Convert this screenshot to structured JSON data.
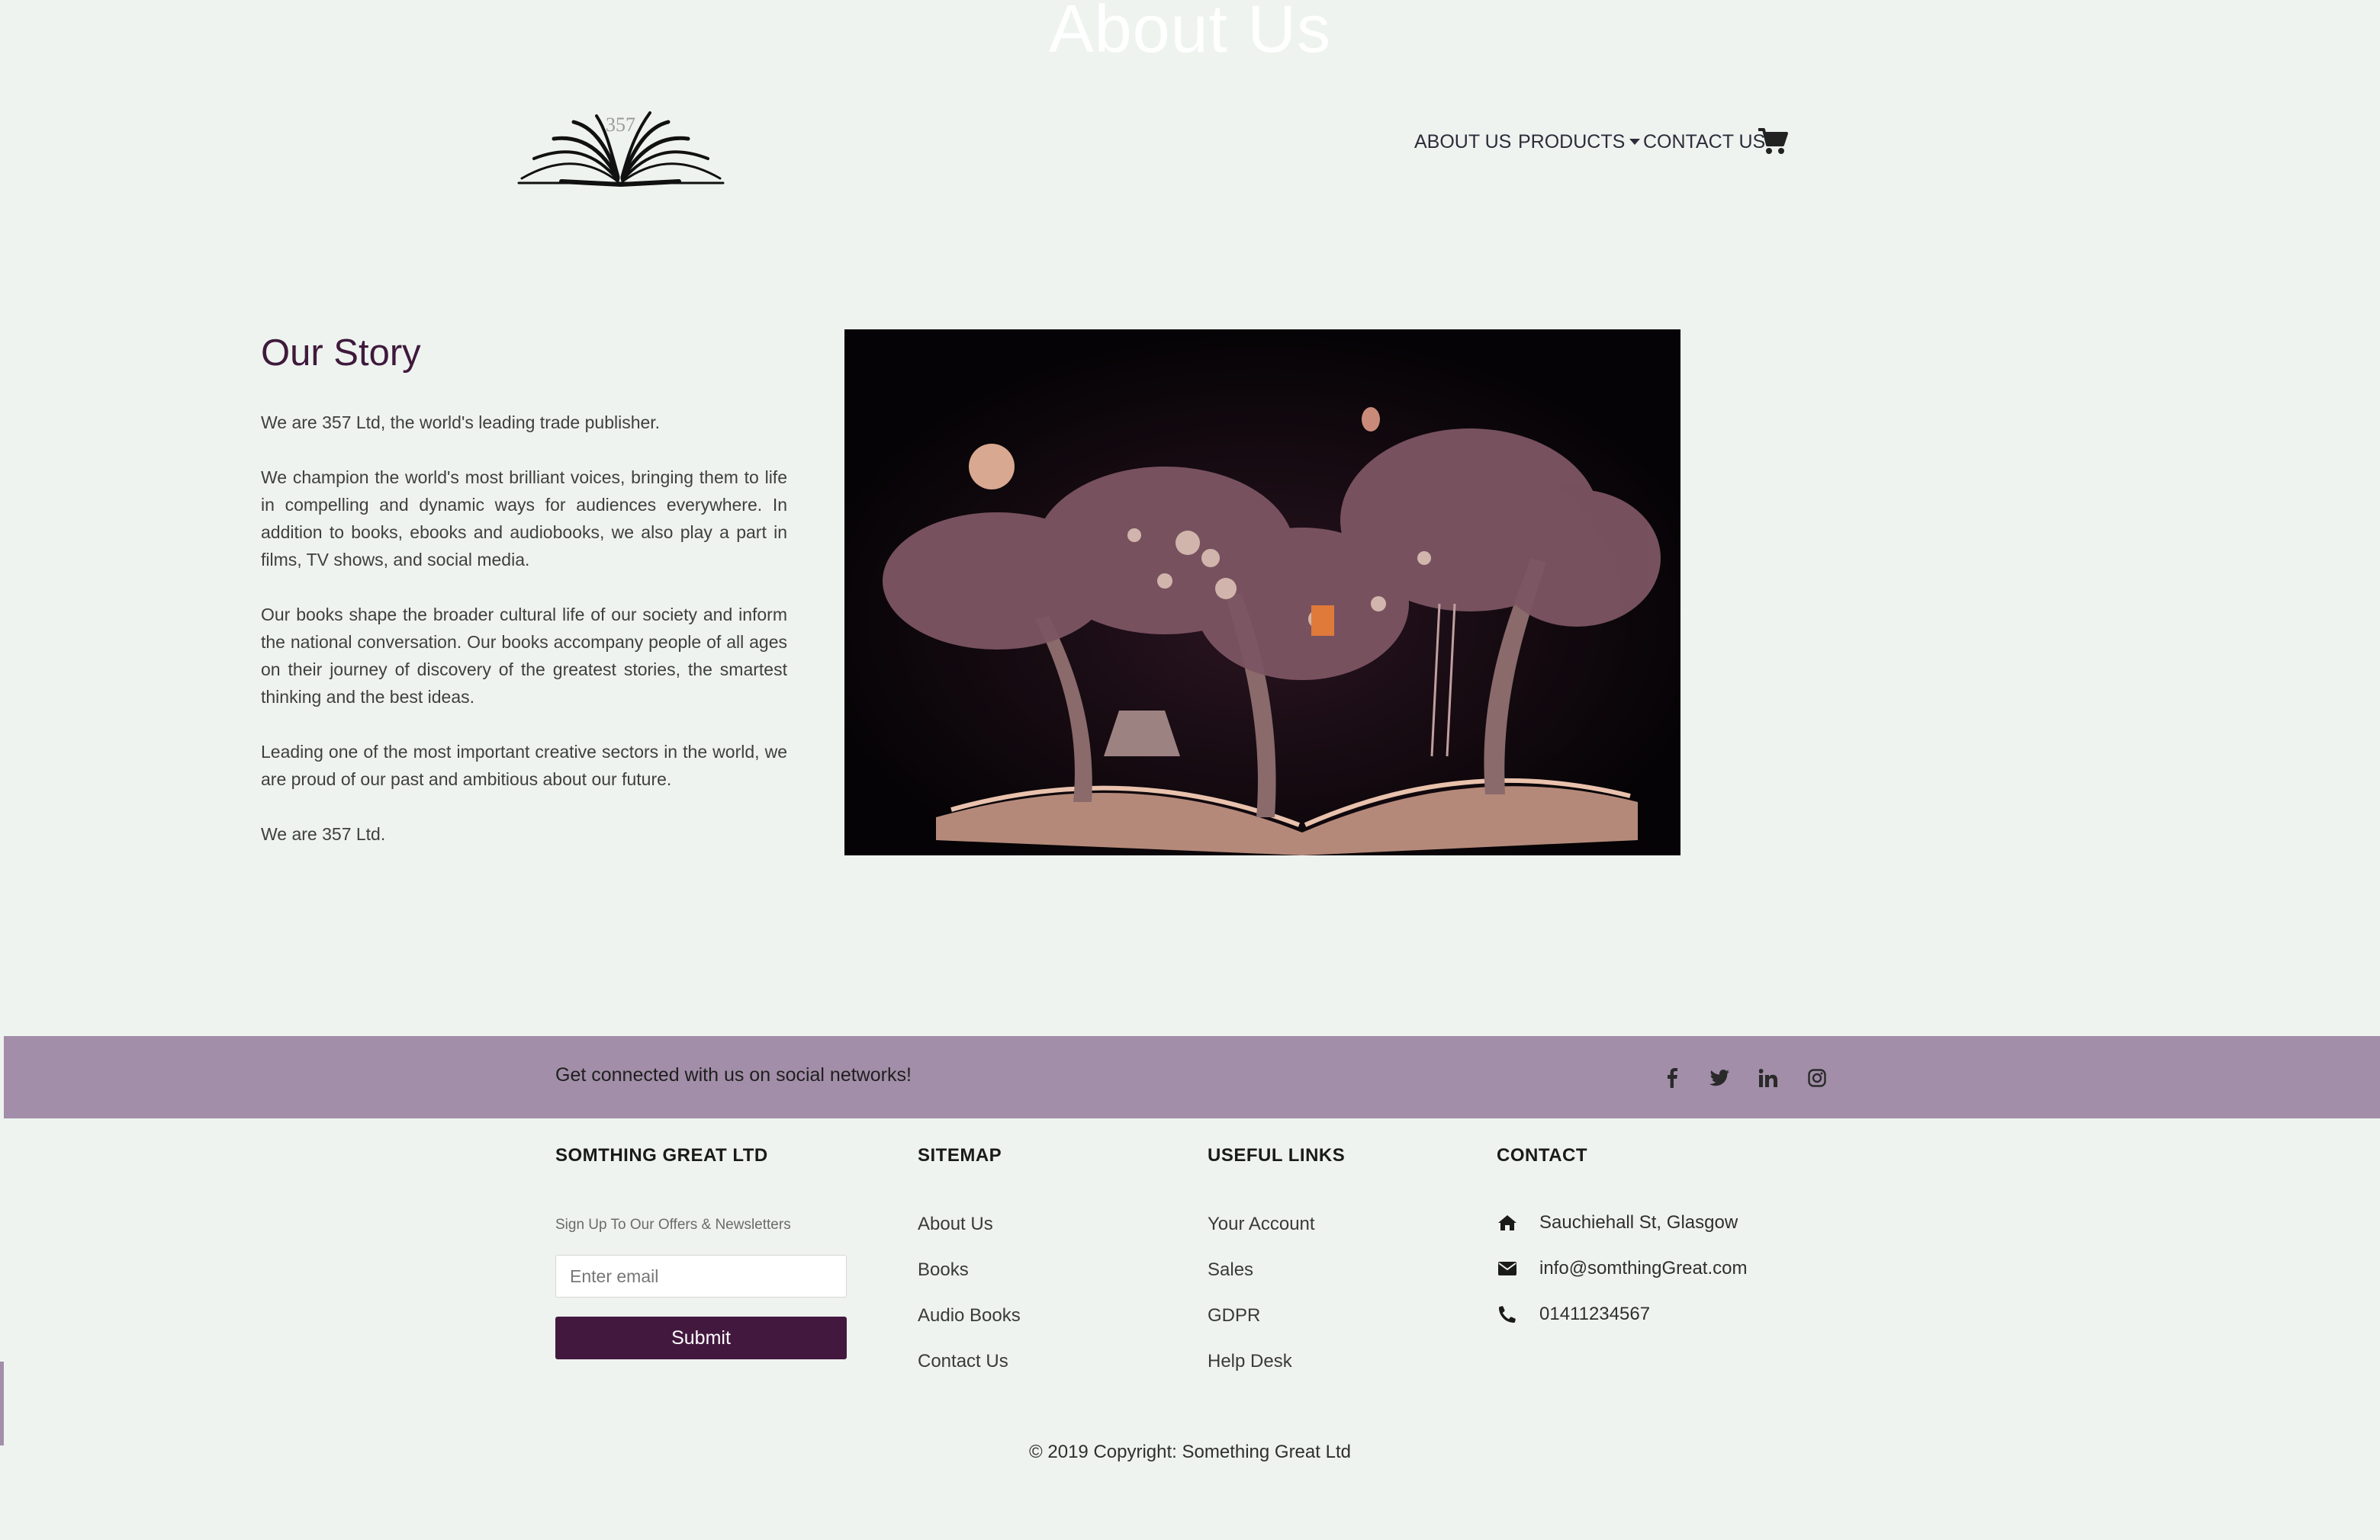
{
  "page": {
    "title": "About Us"
  },
  "logo": {
    "number": "357"
  },
  "nav": {
    "items": [
      {
        "label": "ABOUT US"
      },
      {
        "label": "PRODUCTS"
      },
      {
        "label": "CONTACT US"
      }
    ],
    "cart_icon": "shopping-cart-icon"
  },
  "story": {
    "heading": "Our Story",
    "paragraphs": [
      "We are 357 Ltd, the world's leading trade publisher.",
      "We champion the world's most brilliant voices, bringing them to life in compelling and dynamic ways for audiences everywhere. In addition to books, ebooks and audiobooks, we also play a part in films, TV shows, and social media.",
      "Our books shape the broader cultural life of our society and inform the national conversation. Our books accompany people of all ages on their journey of discovery of the greatest stories, the smartest thinking and the best ideas.",
      "Leading one of the most important creative sectors in the world, we are proud of our past and ambitious about our future.",
      "We are 357 Ltd."
    ]
  },
  "social": {
    "text": "Get connected with us on social networks!",
    "icons": [
      "facebook-icon",
      "twitter-icon",
      "linkedin-icon",
      "instagram-icon"
    ]
  },
  "footer": {
    "company": {
      "title": "SOMTHING GREAT LTD",
      "signup_label": "Sign Up To Our Offers & Newsletters",
      "email_placeholder": "Enter email",
      "submit_label": "Submit"
    },
    "sitemap": {
      "title": "SITEMAP",
      "links": [
        "About Us",
        "Books",
        "Audio Books",
        "Contact Us"
      ]
    },
    "useful_links": {
      "title": "USEFUL LINKS",
      "links": [
        "Your Account",
        "Sales",
        "GDPR",
        "Help Desk"
      ]
    },
    "contact": {
      "title": "CONTACT",
      "address": "Sauchiehall St, Glasgow",
      "email": "info@somthingGreat.com",
      "phone": "01411234567"
    },
    "copyright": "© 2019 Copyright: Something Great Ltd"
  },
  "colors": {
    "background": "#eef3ef",
    "heading": "#3f1a3c",
    "band": "#a28ea8",
    "button": "#43183f"
  }
}
